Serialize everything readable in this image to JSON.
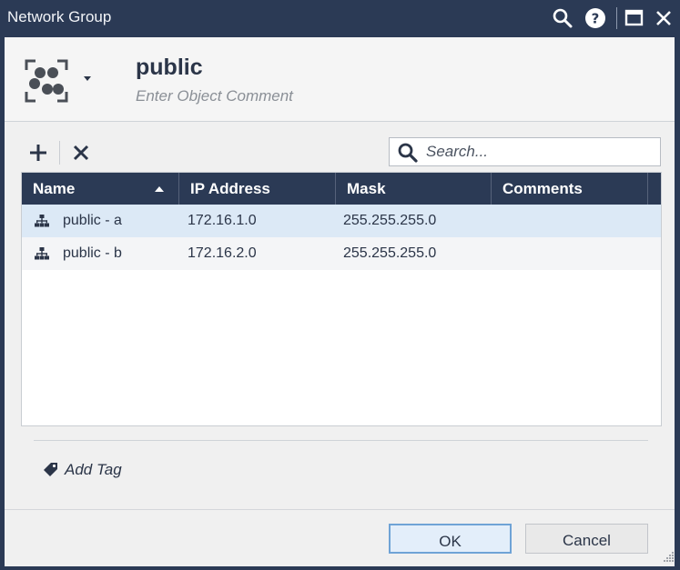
{
  "window": {
    "title": "Network Group"
  },
  "object": {
    "name": "public",
    "comment_placeholder": "Enter Object Comment"
  },
  "toolbar": {
    "add_icon": "plus-icon",
    "delete_icon": "x-icon"
  },
  "search": {
    "placeholder": "Search...",
    "value": ""
  },
  "table": {
    "columns": [
      {
        "label": "Name",
        "sort": "ascending"
      },
      {
        "label": "IP Address"
      },
      {
        "label": "Mask"
      },
      {
        "label": "Comments"
      }
    ],
    "rows": [
      {
        "name": "public - a",
        "ip": "172.16.1.0",
        "mask": "255.255.255.0",
        "comments": "",
        "selected": true
      },
      {
        "name": "public - b",
        "ip": "172.16.2.0",
        "mask": "255.255.255.0",
        "comments": "",
        "selected": false
      }
    ]
  },
  "tags": {
    "add_label": "Add Tag"
  },
  "buttons": {
    "ok": "OK",
    "cancel": "Cancel"
  },
  "colors": {
    "titlebar": "#2b3a55",
    "selected_row": "#dce9f6",
    "ok_border": "#6fa3d6"
  }
}
